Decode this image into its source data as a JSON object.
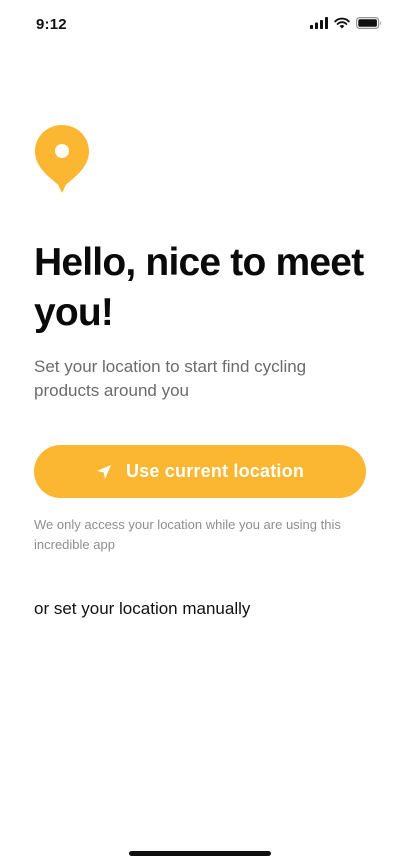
{
  "status_bar": {
    "time": "9:12",
    "icons": [
      "cellular-signal-icon",
      "wifi-icon",
      "battery-icon"
    ]
  },
  "hero": {
    "icon": "location-pin-icon",
    "headline": "Hello, nice to meet you!",
    "subtitle": "Set your location to start find cycling products around you"
  },
  "actions": {
    "primary_icon": "navigation-arrow-icon",
    "primary_label": "Use current location",
    "privacy_note": "We only access your location while you are using this incredible app",
    "manual_link": "or set your location manually"
  },
  "colors": {
    "accent": "#fbb731",
    "text_primary": "#0a0a0a",
    "text_secondary": "#6b6b6b",
    "text_muted": "#8e8e8e",
    "background": "#ffffff"
  }
}
